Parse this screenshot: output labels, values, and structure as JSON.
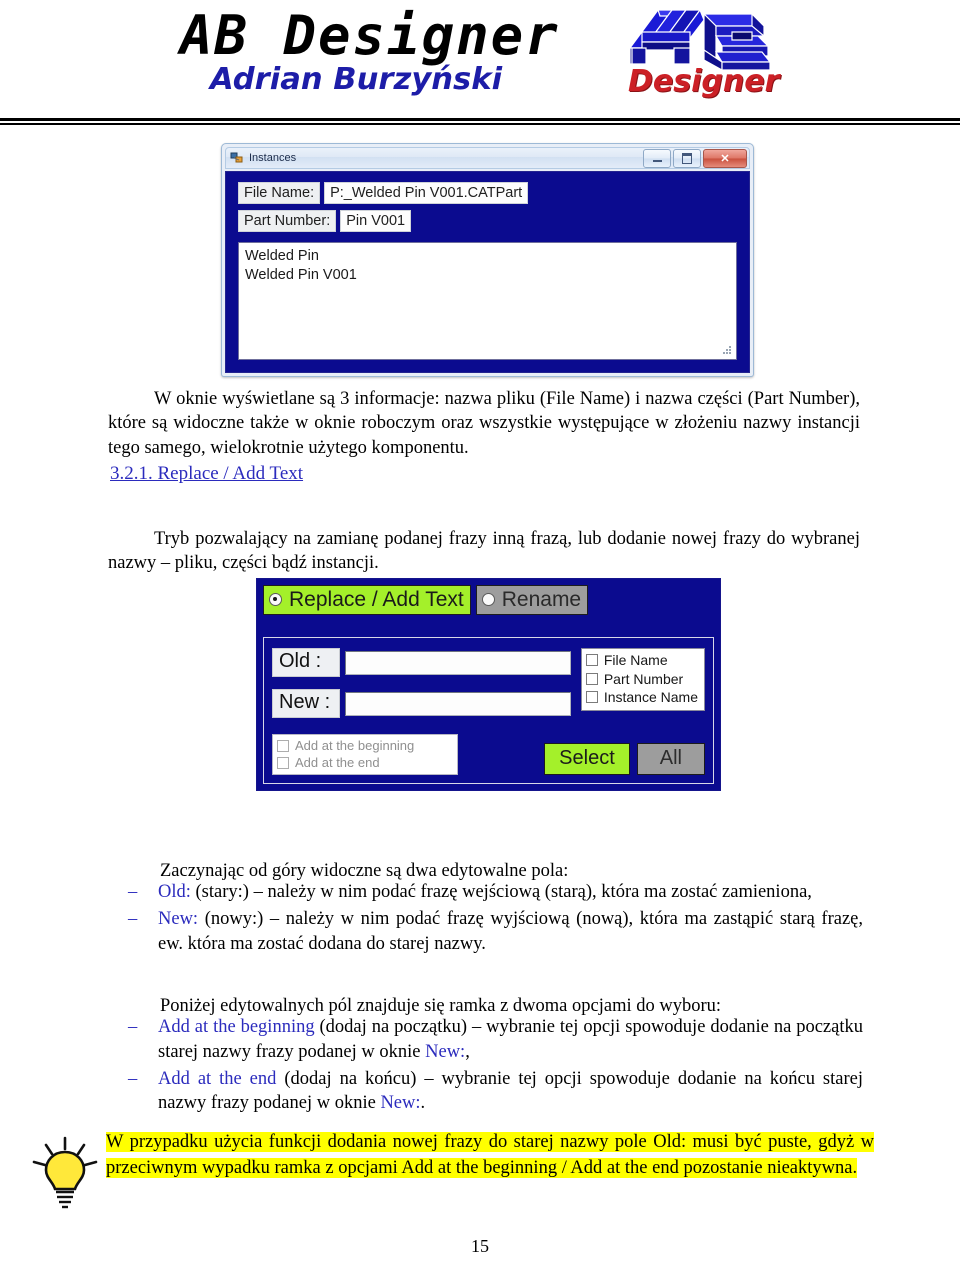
{
  "header": {
    "brand_title": "AB Designer",
    "brand_subtitle": "Adrian Burzyński",
    "logo_text": "Designer"
  },
  "instances_dialog": {
    "title": "Instances",
    "window_icon": "app-icon",
    "minimize_label": "Minimize",
    "maximize_label": "Maximize",
    "close_label": "✕",
    "fields": [
      {
        "label": "File Name:",
        "value": "P:_Welded Pin V001.CATPart"
      },
      {
        "label": "Part Number:",
        "value": "Pin V001"
      }
    ],
    "list_items": [
      "Welded Pin",
      "Welded Pin V001"
    ]
  },
  "replace_dialog": {
    "modes": [
      {
        "label": "Replace / Add Text",
        "selected": true
      },
      {
        "label": "Rename",
        "selected": false
      }
    ],
    "inputs": [
      {
        "label": "Old  :",
        "value": "",
        "placeholder": ""
      },
      {
        "label": "New :",
        "value": "",
        "placeholder": ""
      }
    ],
    "target_checkboxes": [
      {
        "label": "File Name",
        "checked": false
      },
      {
        "label": "Part Number",
        "checked": false
      },
      {
        "label": "Instance Name",
        "checked": false
      }
    ],
    "add_checkboxes": [
      {
        "label": "Add at the beginning",
        "checked": false,
        "disabled": true
      },
      {
        "label": "Add at the end",
        "checked": false,
        "disabled": true
      }
    ],
    "buttons": [
      {
        "label": "Select",
        "style": "primary"
      },
      {
        "label": "All",
        "style": "secondary"
      }
    ]
  },
  "content": {
    "para1": "W oknie wyświetlane są 3 informacje: nazwa pliku (File Name) i nazwa części (Part Number), które są widoczne także w oknie roboczym oraz wszystkie występujące w złożeniu nazwy instancji tego samego, wielokrotnie użytego komponentu.",
    "section_heading": "3.2.1. Replace / Add Text",
    "para2": "Tryb pozwalający na zamianę podanej frazy inną frazą, lub dodanie nowej frazy do wybranej nazwy – pliku, części bądź instancji.",
    "para3": "Zaczynając od góry widoczne są dwa edytowalne pola:",
    "bullets1": [
      {
        "dash": "–",
        "term": "Old:",
        "rest": " (stary:) – należy w nim podać frazę wejściową (starą), która ma zostać zamieniona,"
      },
      {
        "dash": "–",
        "term": "New:",
        "rest": " (nowy:) – należy w nim podać frazę wyjściową (nową), która ma zastąpić starą frazę, ew. która ma zostać dodana do starej nazwy."
      }
    ],
    "para4": "Poniżej edytowalnych pól znajduje się ramka z dwoma opcjami do wyboru:",
    "bullets2": [
      {
        "dash": "–",
        "term": "Add at the beginning",
        "rest": " (dodaj na początku) – wybranie tej opcji spowoduje dodanie na początku starej nazwy frazy podanej w oknie ",
        "term2": "New:",
        "tail": ","
      },
      {
        "dash": "–",
        "term": "Add at the end",
        "rest": " (dodaj na końcu) – wybranie tej opcji spowoduje dodanie na końcu starej nazwy frazy podanej w oknie ",
        "term2": "New:",
        "tail": "."
      }
    ],
    "note": "W przypadku użycia funkcji dodania nowej frazy do starej nazwy pole Old: musi być puste, gdyż w przeciwnym wypadku ramka z opcjami Add at the beginning / Add at the end pozostanie nieaktywna.",
    "note_icon": "lightbulb-icon",
    "page_number": "15"
  },
  "colors": {
    "dialog_blue": "#0b0b8f",
    "accent_green": "#a4f02a",
    "highlight_yellow": "#ffff00",
    "link_blue": "#2b2bbd",
    "logo_red": "#cc2026"
  }
}
